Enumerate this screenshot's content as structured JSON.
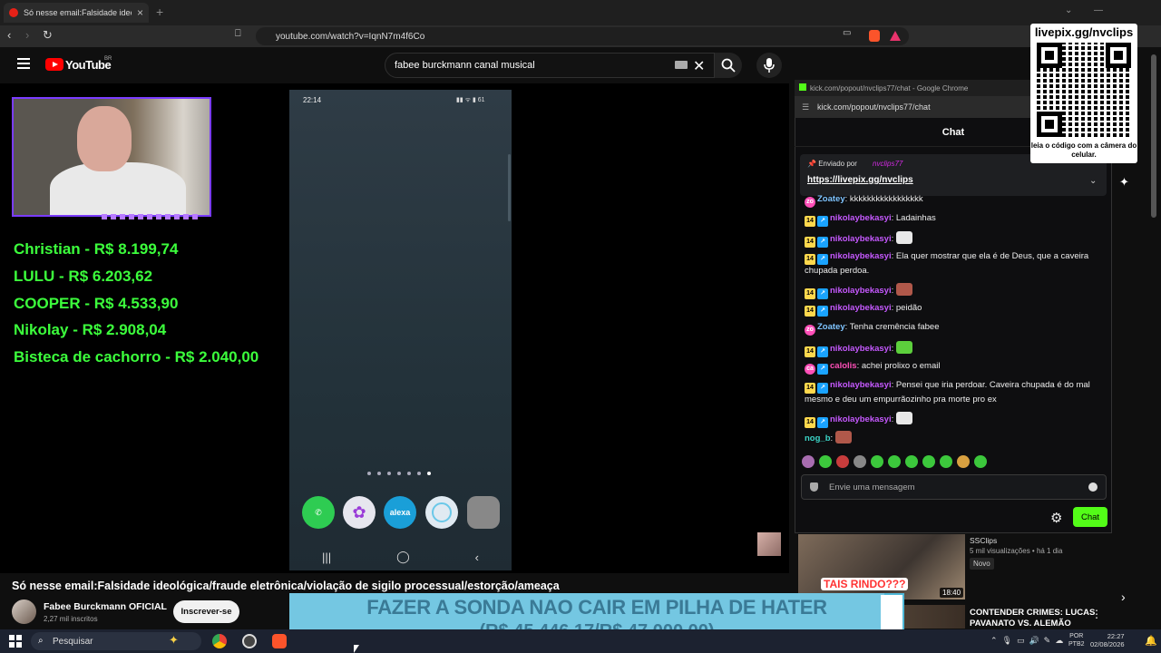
{
  "browser": {
    "tab_title": "Só nesse email:Falsidade ideológ",
    "url": "youtube.com/watch?v=IqnN7m4f6Co",
    "new_tab": "+",
    "close_tab": "×"
  },
  "youtube": {
    "logo_text": "YouTube",
    "region": "BR",
    "search_query": "fabee burckmann canal musical",
    "video_title": "Só nesse email:Falsidade ideológica/fraude eletrônica/violação de sigilo processual/estorção/ameaça",
    "channel_name": "Fabee Burckmann OFICIAL",
    "subscribers": "2,27 mil inscritos",
    "subscribe_label": "Inscrever-se"
  },
  "stream": {
    "donors": [
      "Christian - R$ 8.199,74",
      "LULU - R$ 6.203,62",
      "COOPER - R$ 4.533,90",
      "Nikolay - R$ 2.908,04",
      "Bisteca de cachorro - R$ 2.040,00"
    ],
    "phone": {
      "time": "22:14",
      "status": "▮▮ ᯤ ▮ 61",
      "apps": [
        "",
        "",
        "alexa",
        "",
        ""
      ]
    },
    "goal": {
      "line1": "FAZER A SONDA NAO CAIR EM PILHA DE HATER",
      "line2": "(R$ 45.446,17/R$ 47.000,00)",
      "current": 45446.17,
      "target": 47000.0
    }
  },
  "popout": {
    "window_title": "kick.com/popout/nvclips77/chat - Google Chrome",
    "url": "kick.com/popout/nvclips77/chat",
    "header": "Chat",
    "pinned_by_label": "Enviado por",
    "pinned_user": "nvclips77",
    "pinned_link": "https://livepix.gg/nvclips",
    "messages": [
      {
        "badge": "zo",
        "user": "Zoatey",
        "text": "kkkkkkkkkkkkkkkkk",
        "color": "zoa"
      },
      {
        "badge": "14",
        "user": "nikolaybekasyi",
        "text": "Ladainhas",
        "color": "nik"
      },
      {
        "badge": "14",
        "user": "nikolaybekasyi",
        "text": "",
        "emote": "#e8e8e8",
        "color": "nik"
      },
      {
        "badge": "14",
        "user": "nikolaybekasyi",
        "text": "Ela quer mostrar que ela é de Deus, que a caveira chupada perdoa.",
        "color": "nik"
      },
      {
        "badge": "14",
        "user": "nikolaybekasyi",
        "text": "",
        "emote": "#b0584a",
        "color": "nik"
      },
      {
        "badge": "14",
        "user": "nikolaybekasyi",
        "text": "peidão",
        "color": "nik"
      },
      {
        "badge": "zo",
        "user": "Zoatey",
        "text": "Tenha cremência fabee",
        "color": "zoa"
      },
      {
        "badge": "14",
        "user": "nikolaybekasyi",
        "text": "",
        "emote": "#5ccf3c",
        "color": "nik"
      },
      {
        "badge": "ca",
        "user": "calolis",
        "text": "achei prolixo o email",
        "color": "cal"
      },
      {
        "badge": "14",
        "user": "nikolaybekasyi",
        "text": "Pensei que iria perdoar. Caveira chupada é do mal mesmo e deu um empurrãozinho pra morte pro ex",
        "color": "nik"
      },
      {
        "badge": "14",
        "user": "nikolaybekasyi",
        "text": "",
        "emote": "#e8e8e8",
        "color": "nik"
      },
      {
        "badge": "",
        "user": "nog_b",
        "text": "",
        "emote": "#b0584a",
        "color": "nog"
      }
    ],
    "input_placeholder": "Envie uma mensagem",
    "chat_button": "Chat",
    "emote_bar_colors": [
      "#a86db0",
      "#3cc83c",
      "#c83c3c",
      "#888888",
      "#3cc83c",
      "#3cc83c",
      "#3cc83c",
      "#3cc83c",
      "#3cc83c",
      "#d8a040",
      "#3cc83c"
    ]
  },
  "qr_overlay": {
    "title": "livepix.gg/nvclips",
    "caption": "leia o código com a câmera do celular."
  },
  "suggested": [
    {
      "caption": "TAIS RINDO???",
      "duration": "18:40",
      "channel": "SSClips",
      "meta": "5 mil visualizações • há 1 dia",
      "badge": "Novo"
    },
    {
      "title": "CONTENDER CRIMES: LUCAS PAVANATO VS. ALEMÃO"
    }
  ],
  "taskbar": {
    "search_label": "Pesquisar",
    "lang_line1": "POR",
    "lang_line2": "PTB2",
    "time": "22:27",
    "date": "02/08/2026"
  },
  "colors": {
    "kick_green": "#53fc18",
    "donor_green": "#3cff3c",
    "goal_blue": "#74c7e2"
  }
}
